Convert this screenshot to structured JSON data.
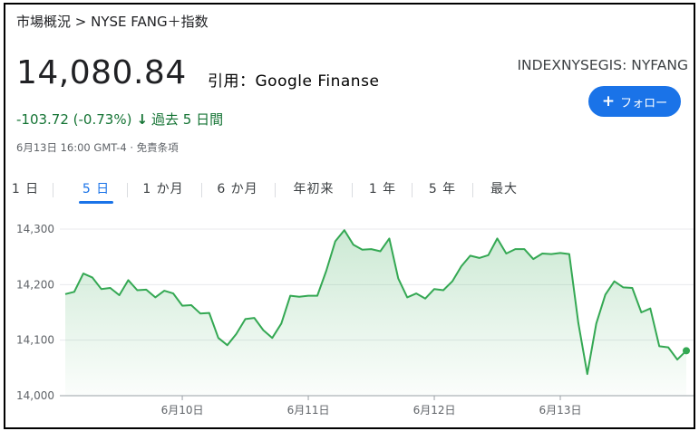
{
  "breadcrumb": "市場概況 > NYSE FANG＋指数",
  "price": "14,080.84",
  "credit": "引用：Google Finanse",
  "ticker": "INDEXNYSEGIS: NYFANG",
  "follow_button": {
    "icon": "plus-icon",
    "label": "フォロー"
  },
  "change": {
    "text": "-103.72 (-0.73%)",
    "icon": "arrow-down-icon",
    "period": "過去 5 日間",
    "color": "#137333"
  },
  "timestamp": "6月13日 16:00 GMT-4 · 免責条項",
  "tabs": [
    {
      "label": "1 日"
    },
    {
      "label": "5 日",
      "active": true
    },
    {
      "label": "1 か月"
    },
    {
      "label": "6 か月"
    },
    {
      "label": "年初来"
    },
    {
      "label": "1 年"
    },
    {
      "label": "5 年"
    },
    {
      "label": "最大"
    }
  ],
  "colors": {
    "accent": "#1a73e8",
    "line": "#34a853",
    "fill": "#e6f4ea",
    "text": "#202124"
  },
  "chart_data": {
    "type": "area",
    "ylim": [
      14000,
      14320
    ],
    "y_ticks": [
      {
        "value": 14000,
        "label": "14,000"
      },
      {
        "value": 14100,
        "label": "14,100"
      },
      {
        "value": 14200,
        "label": "14,200"
      },
      {
        "value": 14300,
        "label": "14,300"
      }
    ],
    "x_ticks": [
      {
        "index": 13,
        "label": "6月10日"
      },
      {
        "index": 27,
        "label": "6月11日"
      },
      {
        "index": 41,
        "label": "6月12日"
      },
      {
        "index": 55,
        "label": "6月13日"
      }
    ],
    "values": [
      14183,
      14187,
      14220,
      14213,
      14192,
      14194,
      14181,
      14208,
      14190,
      14191,
      14177,
      14189,
      14184,
      14162,
      14163,
      14148,
      14149,
      14104,
      14091,
      14111,
      14138,
      14140,
      14118,
      14104,
      14130,
      14180,
      14178,
      14180,
      14180,
      14225,
      14278,
      14298,
      14272,
      14263,
      14264,
      14260,
      14283,
      14211,
      14177,
      14184,
      14175,
      14192,
      14190,
      14206,
      14233,
      14252,
      14248,
      14253,
      14283,
      14256,
      14264,
      14264,
      14246,
      14256,
      14255,
      14257,
      14255,
      14131,
      14039,
      14130,
      14182,
      14206,
      14195,
      14194,
      14150,
      14157,
      14089,
      14087,
      14065,
      14081
    ]
  }
}
